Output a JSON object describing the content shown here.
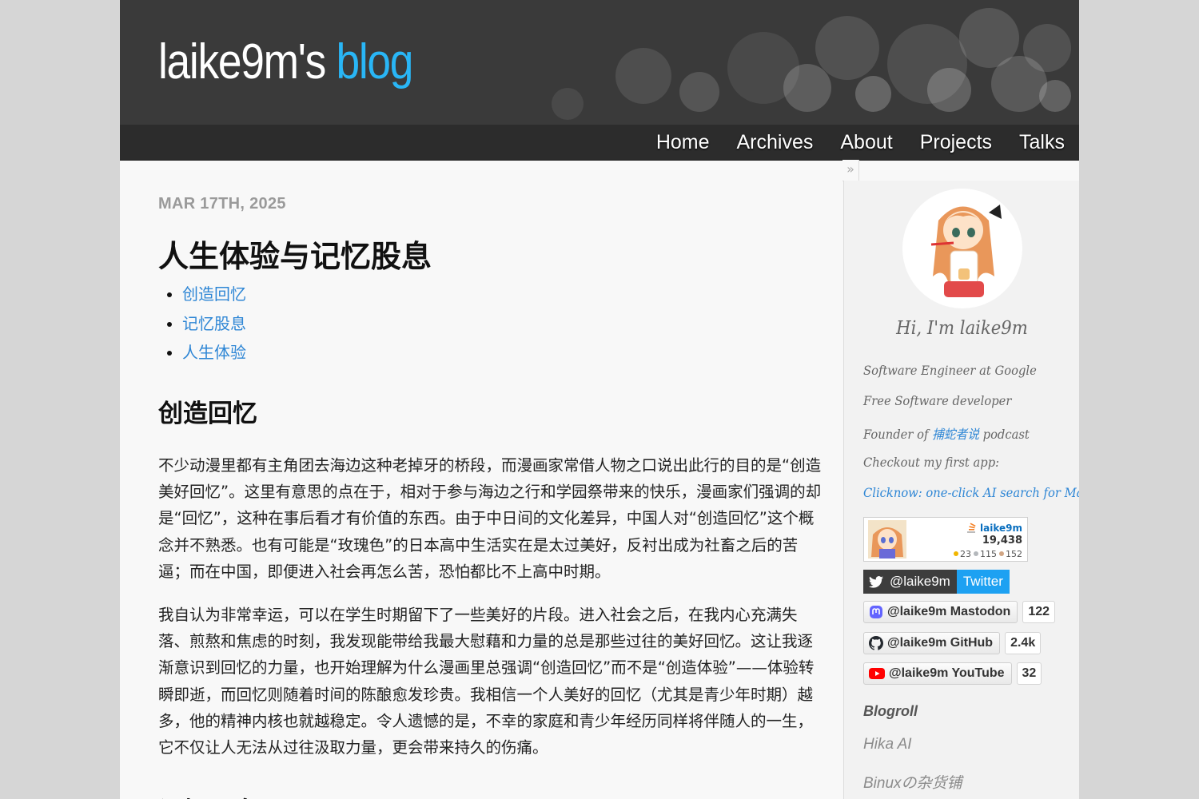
{
  "site": {
    "title_main": "laike9m's",
    "title_accent": "blog"
  },
  "nav": {
    "items": [
      "Home",
      "Archives",
      "About",
      "Projects",
      "Talks"
    ]
  },
  "post": {
    "date": "MAR 17TH, 2025",
    "title": "人生体验与记忆股息",
    "toc": [
      "创造回忆",
      "记忆股息",
      "人生体验"
    ],
    "section1_heading": "创造回忆",
    "paragraph1": "不少动漫里都有主角团去海边这种老掉牙的桥段，而漫画家常借人物之口说出此行的目的是“创造美好回忆”。这里有意思的点在于，相对于参与海边之行和学园祭带来的快乐，漫画家们强调的却是“回忆”，这种在事后看才有价值的东西。由于中日间的文化差异，中国人对“创造回忆”这个概念并不熟悉。也有可能是“玫瑰色”的日本高中生活实在是太过美好，反衬出成为社畜之后的苦逼；而在中国，即便进入社会再怎么苦，恐怕都比不上高中时期。",
    "paragraph2": "我自认为非常幸运，可以在学生时期留下了一些美好的片段。进入社会之后，在我内心充满失落、煎熬和焦虑的时刻，我发现能带给我最大慰藉和力量的总是那些过往的美好回忆。这让我逐渐意识到回忆的力量，也开始理解为什么漫画里总强调“创造回忆”而不是“创造体验”——体验转瞬即逝，而回忆则随着时间的陈酿愈发珍贵。我相信一个人美好的回忆（尤其是青少年时期）越多，他的精神内核也就越稳定。令人遗憾的是，不幸的家庭和青少年经历同样将伴随人的一生，它不仅让人无法从过往汲取力量，更会带来持久的伤痛。",
    "section2_heading": "记忆股息"
  },
  "sidebar": {
    "collapse_glyph": "»",
    "greeting": "Hi, I'm laike9m",
    "line1": "Software Engineer at Google",
    "line2": "Free Software developer",
    "line3_prefix": "Founder of ",
    "line3_link": "捕蛇者说",
    "line3_suffix": " podcast",
    "line4": "Checkout my first app:",
    "line5_link": "Clicknow: one-click AI search for Mac",
    "so": {
      "name": "laike9m",
      "reputation": "19,438",
      "gold": "23",
      "silver": "115",
      "bronze": "152",
      "gold_color": "#f1b600",
      "silver_color": "#b4b8bc",
      "bronze_color": "#d1a684"
    },
    "twitter": {
      "handle": "@laike9m",
      "label": "Twitter",
      "color": "#1da1f2"
    },
    "mastodon": {
      "label": "@laike9m Mastodon",
      "count": "122",
      "color": "#6364ff"
    },
    "github": {
      "label": "@laike9m GitHub",
      "count": "2.4k"
    },
    "youtube": {
      "label": "@laike9m YouTube",
      "count": "32",
      "color": "#ff0000"
    },
    "blogroll_heading": "Blogroll",
    "blogroll": [
      "Hika AI",
      "Binuxの杂货铺"
    ]
  }
}
